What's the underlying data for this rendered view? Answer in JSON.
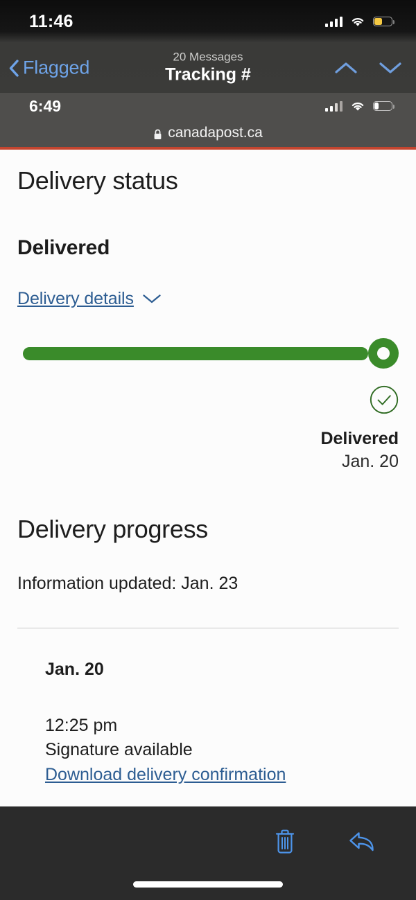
{
  "mail": {
    "status_bar": {
      "time": "11:46",
      "cellular_icon": "cellular-bars-icon",
      "wifi_icon": "wifi-icon",
      "battery_icon": "battery-low-power-icon",
      "battery_color": "#f5c943",
      "battery_level_pct": 46
    },
    "nav": {
      "back_label": "Flagged",
      "back_icon": "chevron-left-icon",
      "subtitle": "20 Messages",
      "title": "Tracking #",
      "prev_icon": "chevron-up-icon",
      "next_icon": "chevron-down-icon",
      "tint_color": "#6ea3e8"
    },
    "toolbar": {
      "trash_icon": "trash-icon",
      "reply_icon": "reply-arrow-icon",
      "tint_color": "#4d94ea"
    }
  },
  "safari": {
    "status_bar": {
      "time": "6:49",
      "cellular_icon": "cellular-bars-icon",
      "wifi_icon": "wifi-icon",
      "battery_icon": "battery-icon",
      "battery_color": "#ffffff",
      "battery_level_pct": 26
    },
    "address": {
      "lock_icon": "lock-icon",
      "url": "canadapost.ca"
    },
    "brand_rule_color": "#c4452f"
  },
  "page": {
    "accent_green": "#3a8b2a",
    "link_blue": "#2d5d92",
    "delivery_status": {
      "heading": "Delivery status",
      "state": "Delivered",
      "details_link": "Delivery details",
      "details_chevron_icon": "chevron-down-icon",
      "progress_pct": 100,
      "milestone": {
        "check_icon": "check-circle-icon",
        "label": "Delivered",
        "date": "Jan. 20"
      }
    },
    "delivery_progress": {
      "heading": "Delivery progress",
      "information_updated": "Information updated: Jan. 23",
      "events": [
        {
          "date": "Jan. 20",
          "time": "12:25 pm",
          "note": "Signature available",
          "link": "Download delivery confirmation"
        }
      ]
    }
  }
}
